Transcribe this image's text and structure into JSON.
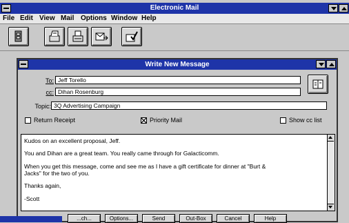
{
  "app": {
    "title": "Electronic Mail"
  },
  "menu": [
    {
      "label": "File"
    },
    {
      "label": "Edit"
    },
    {
      "label": "View"
    },
    {
      "label": "Mail"
    },
    {
      "label": "Options"
    },
    {
      "label": "Window"
    },
    {
      "label": "Help"
    }
  ],
  "toolbar": {
    "icons": [
      "open-mailbox-icon",
      "read-mail-icon",
      "print-mail-icon",
      "forward-mail-icon",
      "check-mail-icon"
    ]
  },
  "compose": {
    "title": "Write New Message",
    "to_label": "To:",
    "to_value": "Jeff Torello",
    "cc_label": "cc:",
    "cc_value": "Dihan Rosenburg",
    "topic_label": "Topic:",
    "topic_value": "3Q Advertising Campaign",
    "return_receipt_label": "Return Receipt",
    "return_receipt_checked": false,
    "priority_mail_label": "Priority Mail",
    "priority_mail_checked": true,
    "show_cc_label": "Show cc list",
    "show_cc_checked": false,
    "body_lines": [
      "Kudos on an excellent proposal, Jeff.",
      "You and Dihan are a great team. You really came through for Galacticomm.",
      "When you get this message, come and see me as I have a gift certificate for dinner at \"Burt &",
      "Jacks\" for the two of you.",
      "Thanks again,",
      "-Scott"
    ],
    "buttons": {
      "attach": "...ch...",
      "options": "Options...",
      "send": "Send",
      "outbox": "Out-Box",
      "cancel": "Cancel",
      "help": "Help"
    }
  },
  "colors": {
    "titlebar": "#1e34a8",
    "window_bg": "#c9c9c9"
  }
}
